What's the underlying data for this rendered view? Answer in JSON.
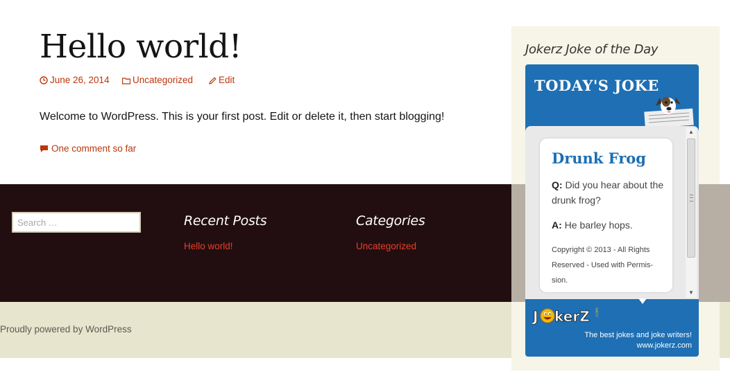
{
  "post": {
    "title": "Hello world!",
    "date": "June 26, 2014",
    "category": "Uncategorized",
    "edit_label": "Edit",
    "body": "Welcome to WordPress. This is your first post. Edit or delete it, then start blogging!",
    "comments_label": "One comment so far"
  },
  "footer_widgets": {
    "search_placeholder": "Search …",
    "recent_posts": {
      "title": "Recent Posts",
      "items": [
        "Hello world!"
      ]
    },
    "categories": {
      "title": "Categories",
      "items": [
        "Uncategorized"
      ]
    }
  },
  "site_footer": {
    "credit": "Proudly powered by WordPress"
  },
  "sidebar": {
    "widget_title": "Jokerz Joke of the Day",
    "joke_widget": {
      "header": "TODAY'S JOKE",
      "joke_title": "Drunk Frog",
      "question_prefix": "Q:",
      "question": "Did you hear about the drunk frog?",
      "answer_prefix": "A:",
      "answer": "He barley hops.",
      "copyright": "Copyright © 2013 - All Rights Reserved - Used with Permis- sion.",
      "logo_text": "JokerZ",
      "logo_suffix": ".com",
      "tagline_line1": "The best jokes and joke writers!",
      "tagline_line2": "www.jokerz.com",
      "icons": [
        "dog-newspaper-image",
        "scroll-up-arrow-icon",
        "scroll-down-arrow-icon"
      ]
    }
  },
  "colors": {
    "link": "#bc360a",
    "footer_link": "#e63f2a",
    "widgets_band": "#220e10",
    "site_footer": "#e8e5ce",
    "sidebar": "#f7f5e7",
    "joke_blue": "#1e6fb4"
  }
}
